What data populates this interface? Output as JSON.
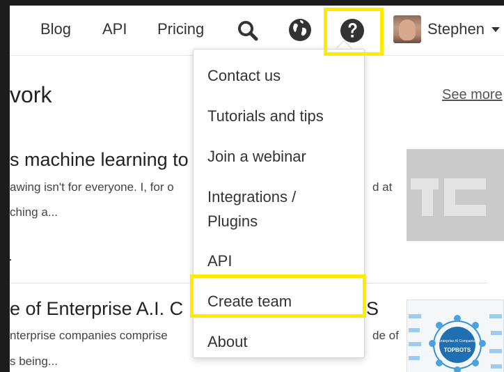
{
  "nav": {
    "links": [
      "Blog",
      "API",
      "Pricing"
    ],
    "icons": [
      "search-icon",
      "globe-icon",
      "help-icon"
    ],
    "user_name": "Stephen"
  },
  "section": {
    "title": "vork",
    "see_more": "See more"
  },
  "articles": [
    {
      "title": "s machine learning to",
      "line1": "awing isn't for everyone. I, for o",
      "line1_tail": "d at",
      "line2": "ching a...",
      "thumbnail_text": "TC"
    },
    {
      "title": "e of Enterprise A.I. C",
      "title_tail": "S",
      "line1": "nterprise companies comprise",
      "line1_tail": "de of",
      "line2": "s being...",
      "thumbnail_title": "Enterprise AI Companies",
      "thumbnail_brand": "TOPBOTS"
    }
  ],
  "help_menu": {
    "items": [
      "Contact us",
      "Tutorials and tips",
      "Join a webinar",
      "Integrations /",
      "Plugins",
      "API",
      "Create team",
      "About"
    ]
  },
  "highlight_color": "#ffea00"
}
